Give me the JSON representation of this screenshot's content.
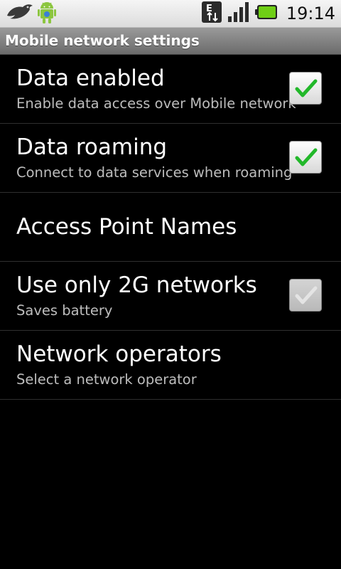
{
  "status_bar": {
    "left_icons": [
      "bird-icon",
      "android-robot-icon"
    ],
    "right_icons": [
      "edge-network-icon",
      "signal-strength-icon",
      "battery-icon"
    ],
    "network_type": "E",
    "time": "19:14"
  },
  "header": {
    "title": "Mobile network settings"
  },
  "preferences": [
    {
      "title": "Data enabled",
      "summary": "Enable data access over Mobile network",
      "checked": true,
      "enabled": true
    },
    {
      "title": "Data roaming",
      "summary": "Connect to data services when roaming",
      "checked": true,
      "enabled": true
    },
    {
      "title": "Access Point Names",
      "summary": ""
    },
    {
      "title": "Use only 2G networks",
      "summary": "Saves battery",
      "checked": true,
      "enabled": false
    },
    {
      "title": "Network operators",
      "summary": "Select a network operator"
    }
  ],
  "colors": {
    "check_green": "#22b82a",
    "check_disabled": "#e4e4e4",
    "background": "#000000"
  }
}
